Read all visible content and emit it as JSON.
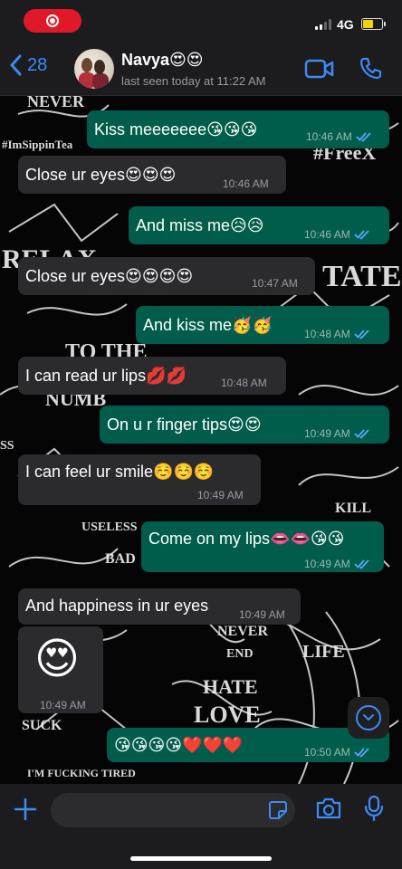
{
  "status_bar": {
    "network": "4G"
  },
  "header": {
    "back_count": "28",
    "contact_name": "Navya",
    "name_emojis": "😍😍",
    "last_seen": "last seen today at 11:22 AM"
  },
  "messages": [
    {
      "dir": "out",
      "text": "Kiss meeeeeee😘😘😘",
      "time": "10:46 AM",
      "read": true
    },
    {
      "dir": "in",
      "text": "Close ur eyes😍😍😍",
      "time": "10:46 AM"
    },
    {
      "dir": "out",
      "text": "And miss me😥😥",
      "time": "10:46 AM",
      "read": true
    },
    {
      "dir": "in",
      "text": "Close ur eyes😍😍😍😍",
      "time": "10:47 AM"
    },
    {
      "dir": "out",
      "text": "And kiss me🥳🥳",
      "time": "10:48 AM",
      "read": true
    },
    {
      "dir": "in",
      "text": "I can read ur lips💋💋",
      "time": "10:48 AM"
    },
    {
      "dir": "out",
      "text": "On u r finger tips😍😍",
      "time": "10:49 AM",
      "read": true
    },
    {
      "dir": "in",
      "text": "I can feel ur smile☺️☺️☺️",
      "time": "10:49 AM"
    },
    {
      "dir": "out",
      "text": "Come on my lips👄👄😘😘",
      "time": "10:49 AM",
      "read": true
    },
    {
      "dir": "in",
      "text": "And happiness in ur eyes",
      "time": "10:49 AM"
    },
    {
      "dir": "in",
      "text": "😍",
      "time": "10:49 AM",
      "big_emoji": true
    },
    {
      "dir": "out",
      "text": "😘😘😘😘❤️❤️❤️",
      "time": "10:50 AM",
      "read": true
    }
  ],
  "input": {
    "placeholder": ""
  },
  "colors": {
    "accent": "#3d8bf7",
    "outgoing": "#005c4b",
    "incoming": "#2b2b2d",
    "recording": "#e0182a"
  },
  "icons": [
    "record-icon",
    "back-chevron-icon",
    "video-call-icon",
    "phone-call-icon",
    "scroll-down-icon",
    "plus-icon",
    "sticker-icon",
    "camera-icon",
    "microphone-icon",
    "read-ticks-icon"
  ]
}
